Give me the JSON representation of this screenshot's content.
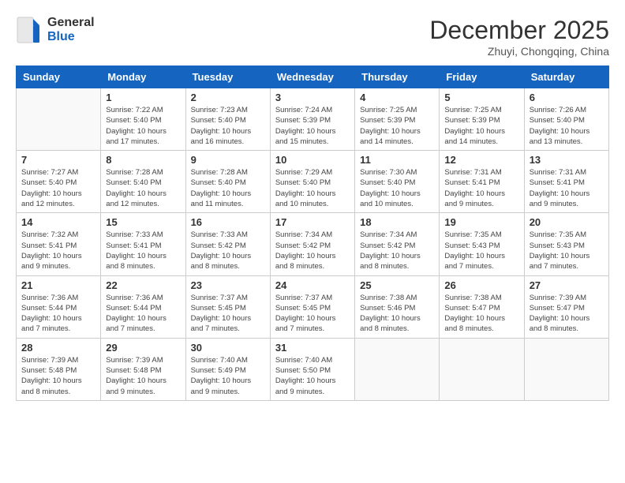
{
  "header": {
    "logo_general": "General",
    "logo_blue": "Blue",
    "month_year": "December 2025",
    "location": "Zhuyi, Chongqing, China"
  },
  "days_of_week": [
    "Sunday",
    "Monday",
    "Tuesday",
    "Wednesday",
    "Thursday",
    "Friday",
    "Saturday"
  ],
  "weeks": [
    [
      {
        "day": "",
        "info": ""
      },
      {
        "day": "1",
        "info": "Sunrise: 7:22 AM\nSunset: 5:40 PM\nDaylight: 10 hours and 17 minutes."
      },
      {
        "day": "2",
        "info": "Sunrise: 7:23 AM\nSunset: 5:40 PM\nDaylight: 10 hours and 16 minutes."
      },
      {
        "day": "3",
        "info": "Sunrise: 7:24 AM\nSunset: 5:39 PM\nDaylight: 10 hours and 15 minutes."
      },
      {
        "day": "4",
        "info": "Sunrise: 7:25 AM\nSunset: 5:39 PM\nDaylight: 10 hours and 14 minutes."
      },
      {
        "day": "5",
        "info": "Sunrise: 7:25 AM\nSunset: 5:39 PM\nDaylight: 10 hours and 14 minutes."
      },
      {
        "day": "6",
        "info": "Sunrise: 7:26 AM\nSunset: 5:40 PM\nDaylight: 10 hours and 13 minutes."
      }
    ],
    [
      {
        "day": "7",
        "info": "Sunrise: 7:27 AM\nSunset: 5:40 PM\nDaylight: 10 hours and 12 minutes."
      },
      {
        "day": "8",
        "info": "Sunrise: 7:28 AM\nSunset: 5:40 PM\nDaylight: 10 hours and 12 minutes."
      },
      {
        "day": "9",
        "info": "Sunrise: 7:28 AM\nSunset: 5:40 PM\nDaylight: 10 hours and 11 minutes."
      },
      {
        "day": "10",
        "info": "Sunrise: 7:29 AM\nSunset: 5:40 PM\nDaylight: 10 hours and 10 minutes."
      },
      {
        "day": "11",
        "info": "Sunrise: 7:30 AM\nSunset: 5:40 PM\nDaylight: 10 hours and 10 minutes."
      },
      {
        "day": "12",
        "info": "Sunrise: 7:31 AM\nSunset: 5:41 PM\nDaylight: 10 hours and 9 minutes."
      },
      {
        "day": "13",
        "info": "Sunrise: 7:31 AM\nSunset: 5:41 PM\nDaylight: 10 hours and 9 minutes."
      }
    ],
    [
      {
        "day": "14",
        "info": "Sunrise: 7:32 AM\nSunset: 5:41 PM\nDaylight: 10 hours and 9 minutes."
      },
      {
        "day": "15",
        "info": "Sunrise: 7:33 AM\nSunset: 5:41 PM\nDaylight: 10 hours and 8 minutes."
      },
      {
        "day": "16",
        "info": "Sunrise: 7:33 AM\nSunset: 5:42 PM\nDaylight: 10 hours and 8 minutes."
      },
      {
        "day": "17",
        "info": "Sunrise: 7:34 AM\nSunset: 5:42 PM\nDaylight: 10 hours and 8 minutes."
      },
      {
        "day": "18",
        "info": "Sunrise: 7:34 AM\nSunset: 5:42 PM\nDaylight: 10 hours and 8 minutes."
      },
      {
        "day": "19",
        "info": "Sunrise: 7:35 AM\nSunset: 5:43 PM\nDaylight: 10 hours and 7 minutes."
      },
      {
        "day": "20",
        "info": "Sunrise: 7:35 AM\nSunset: 5:43 PM\nDaylight: 10 hours and 7 minutes."
      }
    ],
    [
      {
        "day": "21",
        "info": "Sunrise: 7:36 AM\nSunset: 5:44 PM\nDaylight: 10 hours and 7 minutes."
      },
      {
        "day": "22",
        "info": "Sunrise: 7:36 AM\nSunset: 5:44 PM\nDaylight: 10 hours and 7 minutes."
      },
      {
        "day": "23",
        "info": "Sunrise: 7:37 AM\nSunset: 5:45 PM\nDaylight: 10 hours and 7 minutes."
      },
      {
        "day": "24",
        "info": "Sunrise: 7:37 AM\nSunset: 5:45 PM\nDaylight: 10 hours and 7 minutes."
      },
      {
        "day": "25",
        "info": "Sunrise: 7:38 AM\nSunset: 5:46 PM\nDaylight: 10 hours and 8 minutes."
      },
      {
        "day": "26",
        "info": "Sunrise: 7:38 AM\nSunset: 5:47 PM\nDaylight: 10 hours and 8 minutes."
      },
      {
        "day": "27",
        "info": "Sunrise: 7:39 AM\nSunset: 5:47 PM\nDaylight: 10 hours and 8 minutes."
      }
    ],
    [
      {
        "day": "28",
        "info": "Sunrise: 7:39 AM\nSunset: 5:48 PM\nDaylight: 10 hours and 8 minutes."
      },
      {
        "day": "29",
        "info": "Sunrise: 7:39 AM\nSunset: 5:48 PM\nDaylight: 10 hours and 9 minutes."
      },
      {
        "day": "30",
        "info": "Sunrise: 7:40 AM\nSunset: 5:49 PM\nDaylight: 10 hours and 9 minutes."
      },
      {
        "day": "31",
        "info": "Sunrise: 7:40 AM\nSunset: 5:50 PM\nDaylight: 10 hours and 9 minutes."
      },
      {
        "day": "",
        "info": ""
      },
      {
        "day": "",
        "info": ""
      },
      {
        "day": "",
        "info": ""
      }
    ]
  ]
}
